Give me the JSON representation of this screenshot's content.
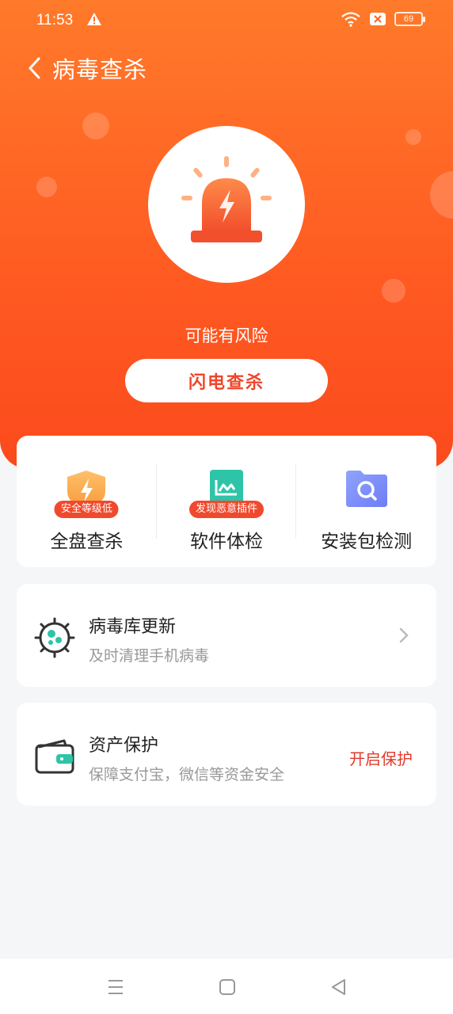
{
  "status": {
    "time": "11:53",
    "battery": "69",
    "icons": [
      "warning-icon",
      "wifi-icon",
      "sim-off-icon",
      "battery-icon"
    ]
  },
  "header": {
    "title": "病毒查杀",
    "back_icon": "chevron-left-icon"
  },
  "hero": {
    "alarm_icon": "alarm-siren-icon",
    "risk_text": "可能有风险",
    "scan_button": "闪电查杀"
  },
  "tools": [
    {
      "label": "全盘查杀",
      "badge": "安全等级低",
      "icon": "shield-lightning-icon"
    },
    {
      "label": "软件体检",
      "badge": "发现恶意插件",
      "icon": "app-check-icon"
    },
    {
      "label": "安装包检测",
      "badge": "",
      "icon": "folder-search-icon"
    }
  ],
  "virus_db": {
    "title": "病毒库更新",
    "subtitle": "及时清理手机病毒",
    "icon": "virus-icon"
  },
  "asset": {
    "title": "资产保护",
    "subtitle": "保障支付宝，微信等资金安全",
    "action": "开启保护",
    "icon": "wallet-icon"
  },
  "colors": {
    "accent": "#ff5a22",
    "badge": "#f04a2e",
    "action": "#e23a2a"
  }
}
